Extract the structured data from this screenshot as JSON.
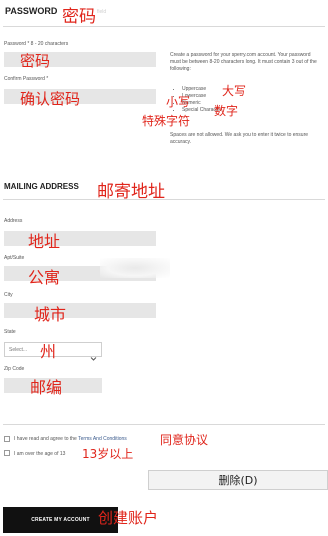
{
  "password_section": {
    "heading": "PASSWORD",
    "heading_annotation": "密码",
    "heading_ghost": "field",
    "password_label": "Password * 8 - 20 characters",
    "password_annotation": "密码",
    "confirm_label": "Confirm Password *",
    "confirm_annotation": "确认密码",
    "help_text": "Create a password for your sperry.com account. Your password must be between 8-20 characters long. It must contain 3 out of the following:",
    "requirements": [
      "Uppercase",
      "Lowercase",
      "Numeric",
      "Special Character"
    ],
    "requirement_annotations": {
      "uppercase": "大写",
      "lowercase": "小写",
      "numeric": "数字",
      "special": "特殊字符"
    },
    "spaces_note": "Spaces are not allowed. We ask you to enter it twice to ensure accuracy."
  },
  "mailing_section": {
    "heading": "MAILING ADDRESS",
    "heading_annotation": "邮寄地址",
    "address_label": "Address",
    "address_annotation": "地址",
    "apt_label": "Apt/Suite",
    "apt_annotation": "公寓",
    "city_label": "City",
    "city_annotation": "城市",
    "state_label": "State",
    "state_placeholder": "Select...",
    "state_annotation": "州",
    "zip_label": "Zip Code",
    "zip_annotation": "邮编"
  },
  "agreements": {
    "terms_prefix": "I have read and agree to the ",
    "terms_link": "Terms And Conditions",
    "terms_annotation": "同意协议",
    "age_text": "I am over the age of 13",
    "age_annotation": "13岁以上"
  },
  "overlay": {
    "delete_label": "删除(D)"
  },
  "actions": {
    "create_account_label": "CREATE MY ACCOUNT",
    "create_account_annotation": "创建账户"
  },
  "colors": {
    "annotation_red": "#e0251b",
    "field_gray": "#e6e6e6",
    "button_black": "#111111",
    "link_blue": "#3a5a8c"
  }
}
